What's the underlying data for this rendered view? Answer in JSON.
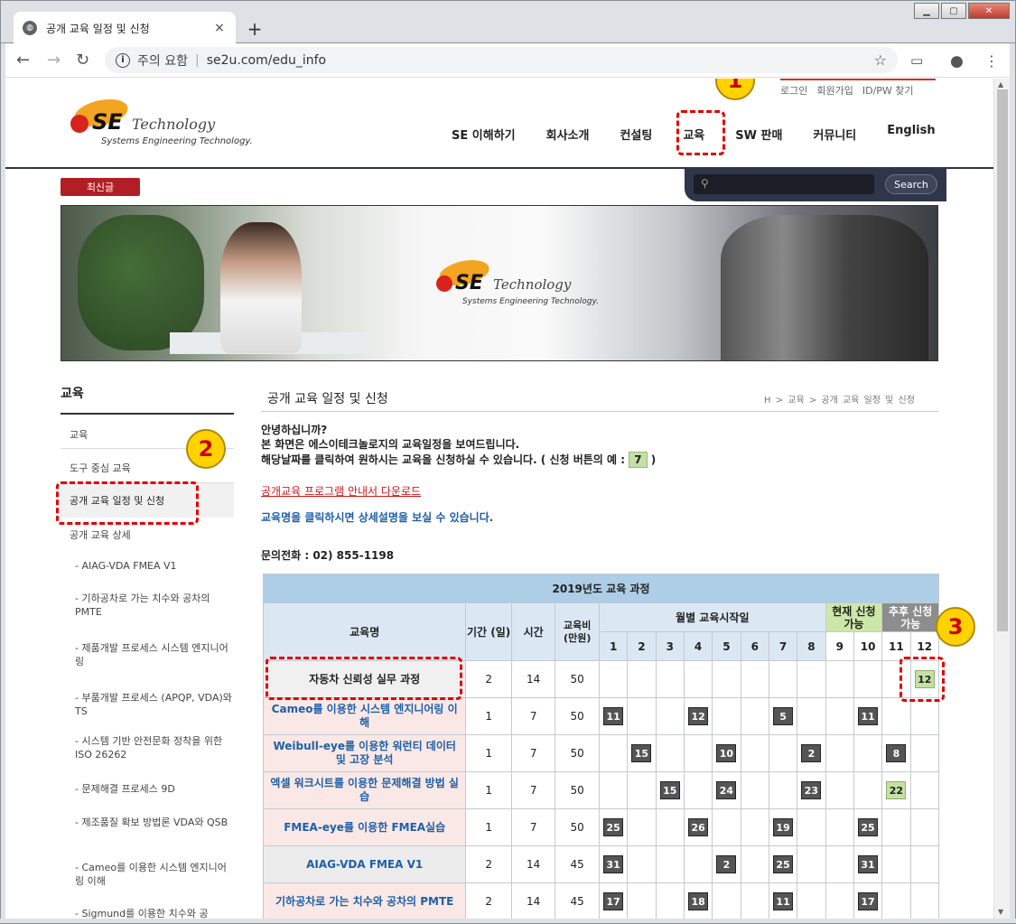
{
  "browser": {
    "tab_title": "공개 교육 일정 및 신청",
    "tab_close": "×",
    "new_tab": "+",
    "address_warning": "주의 요함",
    "address_url": "se2u.com/edu_info",
    "window_min": "▁",
    "window_max": "▢",
    "window_close": "✕"
  },
  "site": {
    "top_links": [
      "로그인",
      "회원가입",
      "ID/PW 찾기"
    ],
    "logo_main": "SE",
    "logo_sub": "Technology",
    "logo_tagline": "Systems Engineering Technology.",
    "nav": [
      "SE 이해하기",
      "회사소개",
      "컨설팅",
      "교육",
      "SW 판매",
      "커뮤니티",
      "English"
    ],
    "latest_label": "최신글",
    "search_button": "Search"
  },
  "sidebar": {
    "title": "교육",
    "items": [
      "교육",
      "도구 중심 교육",
      "공개 교육 일정 및 신청",
      "공개 교육 상세",
      "- AIAG-VDA FMEA V1",
      "- 기하공차로 가는 치수와 공차의 PMTE",
      "- 제품개발 프로세스 시스템 엔지니어링",
      "- 부품개발 프로세스 (APQP, VDA)와 TS",
      "- 시스템 기반 안전문화 정착을 위한 ISO 26262",
      "- 문제해결 프로세스 9D",
      "- 제조품질 확보 방법론 VDA와 QSB",
      "- Cameo를 이용한 시스템 엔지니어링 이해",
      "- Sigmund를 이용한 치수와 공"
    ]
  },
  "content": {
    "title": "공개 교육 일정 및 신청",
    "breadcrumb": "H > 교육 > 공개 교육 일정 및 신청",
    "intro1": "안녕하십니까?",
    "intro2": "본 화면은 에스이테크놀로지의 교육일정을 보여드립니다.",
    "intro3": "해당날짜를 클릭하여 원하시는 교육을 신청하실 수 있습니다. ( 신청 버튼의 예 : ",
    "intro3_example": "7",
    "intro3_end": " )",
    "download_link": "공개교육 프로그램 안내서 다운로드",
    "click_note": "교육명을 클릭하시면 상세설명을 보실 수 있습니다.",
    "phone": "문의전화 : 02) 855-1198"
  },
  "schedule": {
    "year_title": "2019년도 교육 과정",
    "col_name": "교육명",
    "col_days": "기간 (일)",
    "col_hours": "시간",
    "col_fee": "교육비 (만원)",
    "col_monthly": "월별 교육시작일",
    "col_current": "현재 신청 가능",
    "col_future": "추후 신청 가능",
    "months": [
      "1",
      "2",
      "3",
      "4",
      "5",
      "6",
      "7",
      "8",
      "9",
      "10",
      "11",
      "12"
    ],
    "rows": [
      {
        "name": "자동차 신뢰성 실무 과정",
        "days": "2",
        "hours": "14",
        "fee": "50",
        "dates": [
          "",
          "",
          "",
          "",
          "",
          "",
          "",
          "",
          "",
          "",
          "",
          "12"
        ],
        "green": [
          11
        ]
      },
      {
        "name": "Cameo를 이용한 시스템 엔지니어링 이해",
        "days": "1",
        "hours": "7",
        "fee": "50",
        "dates": [
          "11",
          "",
          "",
          "12",
          "",
          "",
          "5",
          "",
          "",
          "11",
          "",
          ""
        ],
        "green": []
      },
      {
        "name": "Weibull-eye를 이용한 워런티 데이터 및 고장 분석",
        "days": "1",
        "hours": "7",
        "fee": "50",
        "dates": [
          "",
          "15",
          "",
          "",
          "10",
          "",
          "",
          "2",
          "",
          "",
          "8",
          ""
        ],
        "green": []
      },
      {
        "name": "엑셀 워크시트를 이용한 문제해결 방법 실습",
        "days": "1",
        "hours": "7",
        "fee": "50",
        "dates": [
          "",
          "",
          "15",
          "",
          "24",
          "",
          "",
          "23",
          "",
          "",
          "22",
          ""
        ],
        "green": [
          10
        ]
      },
      {
        "name": "FMEA-eye를 이용한 FMEA실습",
        "days": "1",
        "hours": "7",
        "fee": "50",
        "dates": [
          "25",
          "",
          "",
          "26",
          "",
          "",
          "19",
          "",
          "",
          "25",
          "",
          ""
        ],
        "green": []
      },
      {
        "name": "AIAG-VDA FMEA V1",
        "days": "2",
        "hours": "14",
        "fee": "45",
        "dates": [
          "31",
          "",
          "",
          "",
          "2",
          "",
          "25",
          "",
          "",
          "31",
          "",
          ""
        ],
        "green": []
      },
      {
        "name": "기하공차로 가는 치수와 공차의 PMTE",
        "days": "2",
        "hours": "14",
        "fee": "45",
        "dates": [
          "17",
          "",
          "",
          "18",
          "",
          "",
          "11",
          "",
          "",
          "17",
          "",
          ""
        ],
        "green": []
      }
    ]
  },
  "annotations": {
    "badge1": "1",
    "badge2": "2",
    "badge3": "3"
  },
  "colors": {
    "accent_red": "#b11f24",
    "nav_dark": "#2f3649",
    "link_blue": "#1e5fa8",
    "annotation_red": "#e40000",
    "badge_yellow": "#ffd200"
  }
}
